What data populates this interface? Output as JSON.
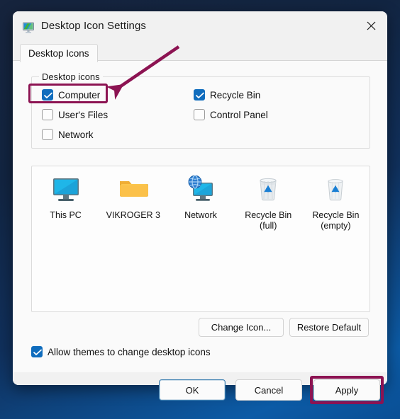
{
  "window": {
    "title": "Desktop Icon Settings",
    "icon": "desktop-monitor-icon",
    "close_label": "✕"
  },
  "tabs": [
    {
      "label": "Desktop Icons",
      "selected": true
    }
  ],
  "groupbox": {
    "label": "Desktop icons",
    "checkboxes": [
      {
        "label": "Computer",
        "checked": true,
        "column": "left",
        "highlighted": true
      },
      {
        "label": "User's Files",
        "checked": false,
        "column": "left",
        "highlighted": false
      },
      {
        "label": "Network",
        "checked": false,
        "column": "left",
        "highlighted": false
      },
      {
        "label": "Recycle Bin",
        "checked": true,
        "column": "right",
        "highlighted": false
      },
      {
        "label": "Control Panel",
        "checked": false,
        "column": "right",
        "highlighted": false
      }
    ]
  },
  "preview": {
    "items": [
      {
        "label": "This PC",
        "icon": "this-pc-monitor-icon"
      },
      {
        "label": "VIKROGER 3",
        "icon": "user-folder-icon"
      },
      {
        "label": "Network",
        "icon": "network-globe-monitor-icon"
      },
      {
        "label": "Recycle Bin\n(full)",
        "icon": "recycle-bin-full-icon"
      },
      {
        "label": "Recycle Bin\n(empty)",
        "icon": "recycle-bin-empty-icon"
      }
    ]
  },
  "mid_buttons": {
    "change_icon": "Change Icon...",
    "restore_default": "Restore Default"
  },
  "allow_themes": {
    "label": "Allow themes to change desktop icons",
    "checked": true
  },
  "footer_buttons": {
    "ok": "OK",
    "cancel": "Cancel",
    "apply": "Apply"
  },
  "annotations": {
    "arrow_color": "#8c1352",
    "highlight_color": "#8c1352",
    "arrow_target": "computer-checkbox",
    "highlighted_elements": [
      "computer-checkbox-row",
      "apply-button"
    ]
  },
  "colors": {
    "accent": "#0f6cbd",
    "annotation": "#8c1352",
    "dialog_bg": "#f1f1f1",
    "page_bg": "#fafafa",
    "focus_border": "#3c7fb1"
  }
}
